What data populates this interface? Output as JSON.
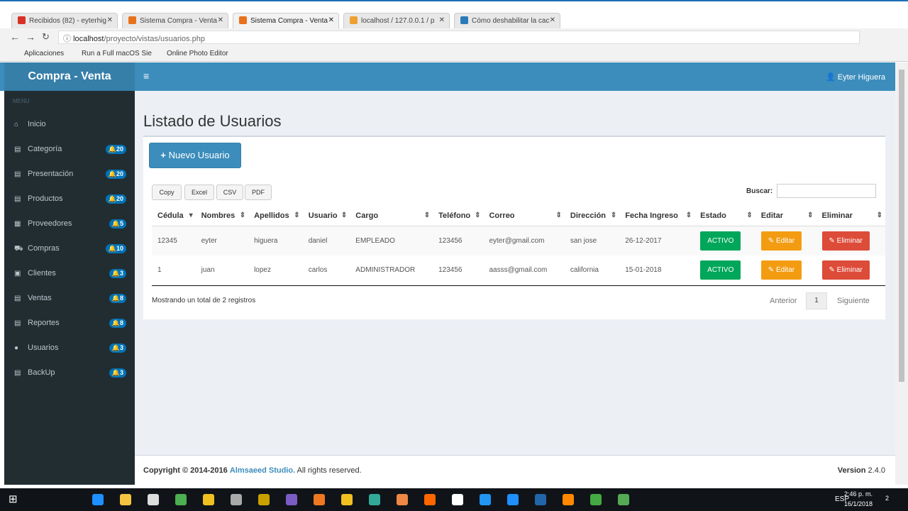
{
  "browser": {
    "tabs": [
      {
        "label": "Recibidos (82) - eyterhig",
        "color": "#d93025"
      },
      {
        "label": "Sistema Compra - Venta",
        "color": "#e8711c"
      },
      {
        "label": "Sistema Compra - Venta",
        "color": "#e8711c"
      },
      {
        "label": "localhost / 127.0.0.1 / p",
        "color": "#f0a030"
      },
      {
        "label": "Cómo deshabilitar la cac",
        "color": "#2a7ab8"
      }
    ],
    "url_host": "localhost",
    "url_path": "/proyecto/vistas/usuarios.php",
    "bookmarks": [
      "Aplicaciones",
      "Run a Full macOS Sie",
      "Online Photo Editor"
    ]
  },
  "app": {
    "logo": "Compra - Venta",
    "user": "Eyter Higuera",
    "menu_header": "MENU"
  },
  "sidebar": [
    {
      "label": "Inicio",
      "icon": "home-icon",
      "badge": null
    },
    {
      "label": "Categoría",
      "icon": "list-icon",
      "badge": "20"
    },
    {
      "label": "Presentación",
      "icon": "list-icon",
      "badge": "20"
    },
    {
      "label": "Productos",
      "icon": "list-icon",
      "badge": "20"
    },
    {
      "label": "Proveedores",
      "icon": "truck-icon",
      "badge": "5"
    },
    {
      "label": "Compras",
      "icon": "cart-icon",
      "badge": "10"
    },
    {
      "label": "Clientes",
      "icon": "users-icon",
      "badge": "3"
    },
    {
      "label": "Ventas",
      "icon": "list-icon",
      "badge": "8"
    },
    {
      "label": "Reportes",
      "icon": "list-icon",
      "badge": "8"
    },
    {
      "label": "Usuarios",
      "icon": "user-icon",
      "badge": "3"
    },
    {
      "label": "BackUp",
      "icon": "list-icon",
      "badge": "3"
    }
  ],
  "page": {
    "title": "Listado de Usuarios",
    "new_button": "Nuevo Usuario",
    "export": [
      "Copy",
      "Excel",
      "CSV",
      "PDF"
    ],
    "search_label": "Buscar:",
    "search_value": "",
    "columns": [
      "Cédula",
      "Nombres",
      "Apellidos",
      "Usuario",
      "Cargo",
      "Teléfono",
      "Correo",
      "Dirección",
      "Fecha Ingreso",
      "Estado",
      "Editar",
      "Eliminar"
    ],
    "rows": [
      [
        "12345",
        "eyter",
        "higuera",
        "daniel",
        "EMPLEADO",
        "123456",
        "eyter@gmail.com",
        "san jose",
        "26-12-2017",
        "ACTIVO",
        "Editar",
        "Eliminar"
      ],
      [
        "1",
        "juan",
        "lopez",
        "carlos",
        "ADMINISTRADOR",
        "123456",
        "aasss@gmail.com",
        "california",
        "15-01-2018",
        "ACTIVO",
        "Editar",
        "Eliminar"
      ]
    ],
    "info": "Mostrando un total de 2 registros",
    "prev": "Anterior",
    "page": "1",
    "next": "Siguiente"
  },
  "footer": {
    "copyright": "Copyright © 2014-2016",
    "company": "Almsaeed Studio.",
    "rights": "All rights reserved.",
    "version_label": "Version",
    "version": "2.4.0"
  },
  "taskbar": {
    "lang": "ESP",
    "time": "2:46 p. m.",
    "date": "16/1/2018",
    "notifications": "2"
  },
  "colors": {
    "primary": "#3c8dbc",
    "success": "#00a65a",
    "warning": "#f39c12",
    "danger": "#dd4b39"
  }
}
